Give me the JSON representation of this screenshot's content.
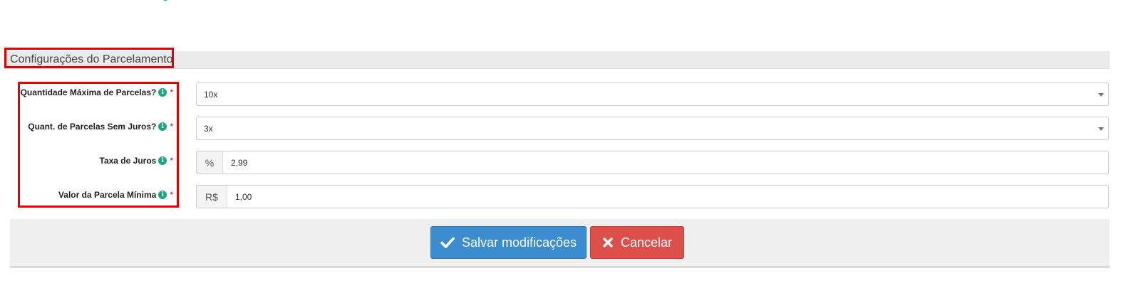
{
  "section": {
    "title": "Configurações do Parcelamento"
  },
  "fields": [
    {
      "label": "Quantidade Máxima de Parcelas?",
      "required": "*",
      "value": "10x"
    },
    {
      "label": "Quant. de Parcelas Sem Juros?",
      "required": "*",
      "value": "3x"
    },
    {
      "label": "Taxa de Juros",
      "required": "*",
      "addon": "%",
      "value": "2,99"
    },
    {
      "label": "Valor da Parcela Mínima",
      "required": "*",
      "addon": "R$",
      "value": "1,00"
    }
  ],
  "actions": {
    "save_label": "Salvar modificações",
    "cancel_label": "Cancelar"
  },
  "icons": {
    "info": "i"
  },
  "colors": {
    "accent": "#3c8dcf",
    "danger": "#dd4f4b",
    "info": "#1ba784",
    "highlight": "#e60000"
  }
}
